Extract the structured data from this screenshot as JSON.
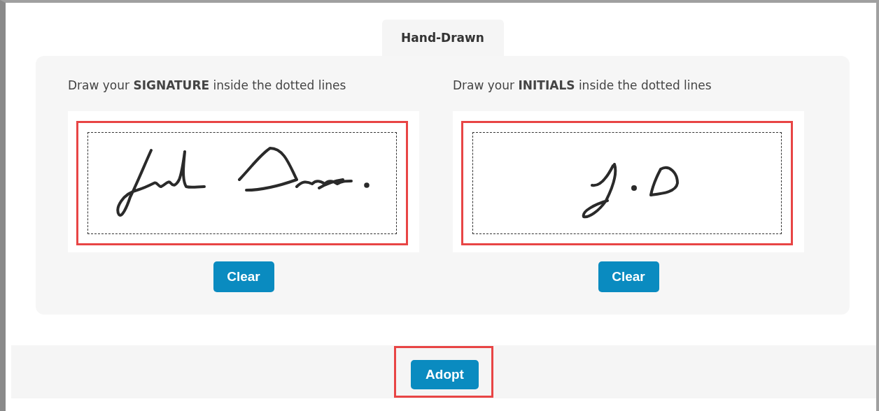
{
  "tabs": [
    {
      "label": "Hand-Drawn",
      "selected": true
    }
  ],
  "pads": [
    {
      "kind": "signature",
      "instruction": "Draw your **SIGNATURE** inside the dotted lines",
      "highlighted": true,
      "button": "Clear"
    },
    {
      "kind": "initials",
      "instruction": "Draw your **INITIALS** inside the dotted lines",
      "highlighted": true,
      "button": "Clear"
    }
  ],
  "footer": {
    "button": "Adopt",
    "highlighted": true
  }
}
